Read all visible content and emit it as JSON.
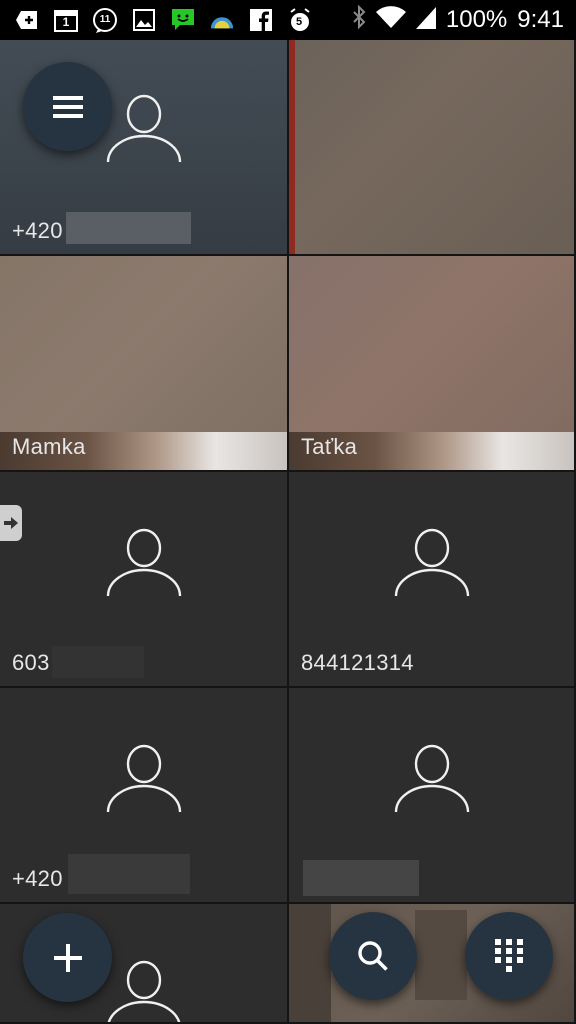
{
  "status_bar": {
    "notification_icons": [
      "add-notification-icon",
      "calendar-icon",
      "messenger-badge-icon",
      "gallery-icon",
      "message-icon",
      "weather-icon",
      "facebook-icon",
      "alarm-badge-icon"
    ],
    "calendar_day": "1",
    "messenger_count": "11",
    "alarm_count": "5",
    "battery": "100%",
    "time": "9:41"
  },
  "contacts": [
    {
      "label": "+420",
      "type": "avatar"
    },
    {
      "label": "",
      "type": "photo"
    },
    {
      "label": "Mamka",
      "type": "photo"
    },
    {
      "label": "Taťka",
      "type": "photo"
    },
    {
      "label": "603",
      "type": "avatar"
    },
    {
      "label": "844121314",
      "type": "avatar"
    },
    {
      "label": "+420",
      "type": "avatar"
    },
    {
      "label": "",
      "type": "avatar"
    },
    {
      "label": "",
      "type": "avatar"
    },
    {
      "label": "",
      "type": "photo"
    }
  ],
  "colors": {
    "fab": "#263442",
    "tile": "#2d2d2d",
    "text": "#e6e6e6"
  }
}
